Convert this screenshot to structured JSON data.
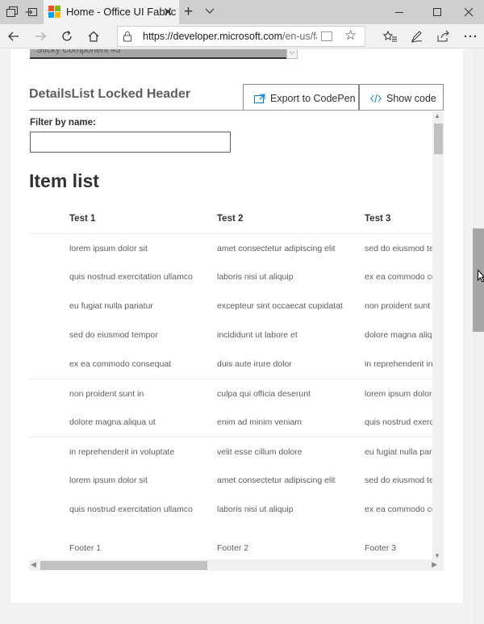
{
  "browser": {
    "tab_title": "Home - Office UI Fabric",
    "url_host": "https://developer.microsoft.com",
    "url_path": "/en-us/fabric",
    "icons": {
      "tab_actions": "tab-actions-icon",
      "set_aside": "set-aside-tabs-icon",
      "favicon": "microsoft-logo-icon",
      "close": "close-icon",
      "new_tab": "plus-icon",
      "tab_menu": "chevron-down-icon",
      "minimize": "minimize-icon",
      "maximize": "maximize-icon",
      "window_close": "close-icon",
      "back": "arrow-left-icon",
      "forward": "arrow-right-icon",
      "refresh": "refresh-icon",
      "home": "home-icon",
      "lock": "lock-icon",
      "reading_view": "reading-view-icon",
      "favorite": "star-icon",
      "favorites_hub": "favorites-list-icon",
      "notes": "pen-icon",
      "share": "share-icon",
      "more": "more-icon"
    }
  },
  "page": {
    "sticky_component_label": "Sticky Component #3",
    "example_title": "DetailsList Locked Header",
    "buttons": {
      "export_label": "Export to CodePen",
      "show_code_label": "Show code"
    },
    "filter_label": "Filter by name:",
    "filter_value": "",
    "item_list_title": "Item list",
    "columns": [
      "Test 1",
      "Test 2",
      "Test 3"
    ],
    "rows": [
      [
        "lorem ipsum dolor sit",
        "amet consectetur adipiscing elit",
        "sed do eiusmod tempor"
      ],
      [
        "quis nostrud exercitation ullamco",
        "laboris nisi ut aliquip",
        "ex ea commodo consequat"
      ],
      [
        "eu fugiat nulla pariatur",
        "excepteur sint occaecat cupidatat",
        "non proident sunt in"
      ],
      [
        "sed do eiusmod tempor",
        "incididunt ut labore et",
        "dolore magna aliqua ut"
      ],
      [
        "ex ea commodo consequat",
        "duis aute irure dolor",
        "in reprehenderit in voluptate"
      ],
      [
        "non proident sunt in",
        "culpa qui officia deserunt",
        "lorem ipsum dolor sit"
      ],
      [
        "dolore magna aliqua ut",
        "enim ad minim veniam",
        "quis nostrud exercitation ullamco"
      ],
      [
        "in reprehenderit in voluptate",
        "velit esse cillum dolore",
        "eu fugiat nulla pariatur"
      ],
      [
        "lorem ipsum dolor sit",
        "amet consectetur adipiscing elit",
        "sed do eiusmod tempor"
      ],
      [
        "quis nostrud exercitation ullamco",
        "laboris nisi ut aliquip",
        "ex ea commodo consequat"
      ]
    ],
    "footers": [
      "Footer 1",
      "Footer 2",
      "Footer 3"
    ]
  },
  "colors": {
    "accent": "#0078d4",
    "text_primary": "#323130",
    "text_secondary": "#605e5c"
  }
}
